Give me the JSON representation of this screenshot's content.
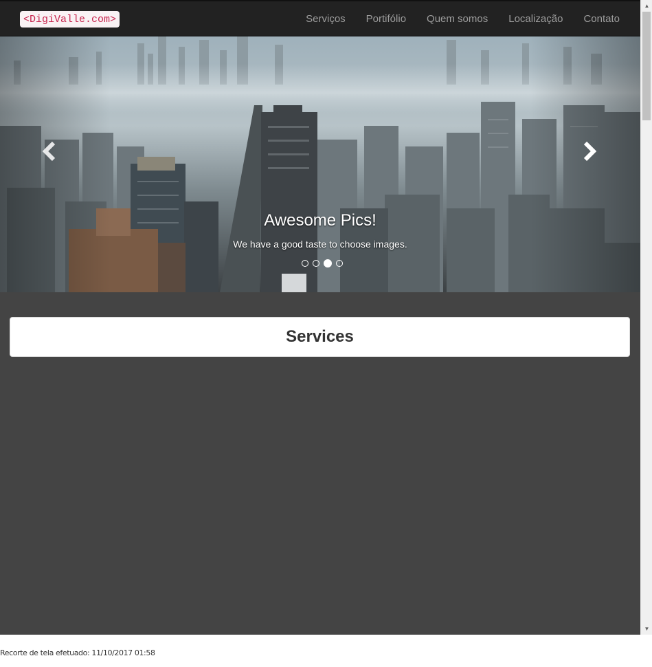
{
  "brand": {
    "label": "<DigiValle.com>"
  },
  "nav": {
    "items": [
      {
        "label": "Serviços"
      },
      {
        "label": "Portifólio"
      },
      {
        "label": "Quem somos"
      },
      {
        "label": "Localização"
      },
      {
        "label": "Contato"
      }
    ]
  },
  "carousel": {
    "title": "Awesome Pics!",
    "text": "We have a good taste to choose images.",
    "slide_count": 4,
    "active_index": 2
  },
  "services": {
    "title_first": "S",
    "title_rest": "ervices"
  },
  "footer": {
    "note": "Recorte de tela efetuado: 11/10/2017 01:58"
  },
  "colors": {
    "navbar": "#222222",
    "nav_link": "#9d9d9d",
    "brand_text": "#c7254e",
    "brand_bg": "#f9f2f4",
    "page_bg": "#444444"
  },
  "icons": {
    "prev": "chevron-left-icon",
    "next": "chevron-right-icon"
  }
}
